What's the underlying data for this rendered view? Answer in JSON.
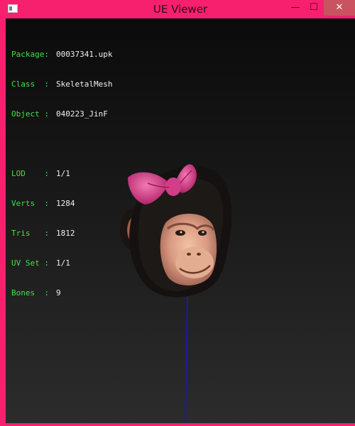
{
  "window": {
    "title": "UE Viewer",
    "minimize_glyph": "—",
    "maximize_glyph": "☐",
    "close_glyph": "✕"
  },
  "info": {
    "package": {
      "label": "Package:",
      "value": "00037341.upk"
    },
    "class": {
      "label": "Class  :",
      "value": "SkeletalMesh"
    },
    "object": {
      "label": "Object :",
      "value": "040223_JinF"
    },
    "lod": {
      "label": "LOD    :",
      "value": "1/1"
    },
    "verts": {
      "label": "Verts  :",
      "value": "1284"
    },
    "tris": {
      "label": "Tris   :",
      "value": "1812"
    },
    "uvset": {
      "label": "UV Set :",
      "value": "1/1"
    },
    "bones": {
      "label": "Bones  :",
      "value": "9"
    }
  },
  "colors": {
    "frame": "#f7206f",
    "label_green": "#42e04a",
    "value_white": "#f0f0f0",
    "bone_line": "#1a1aa8",
    "bow_pink": "#e0448f"
  },
  "icons": [
    "app-icon",
    "chimp-head-mesh",
    "pink-bow",
    "bone-line"
  ]
}
